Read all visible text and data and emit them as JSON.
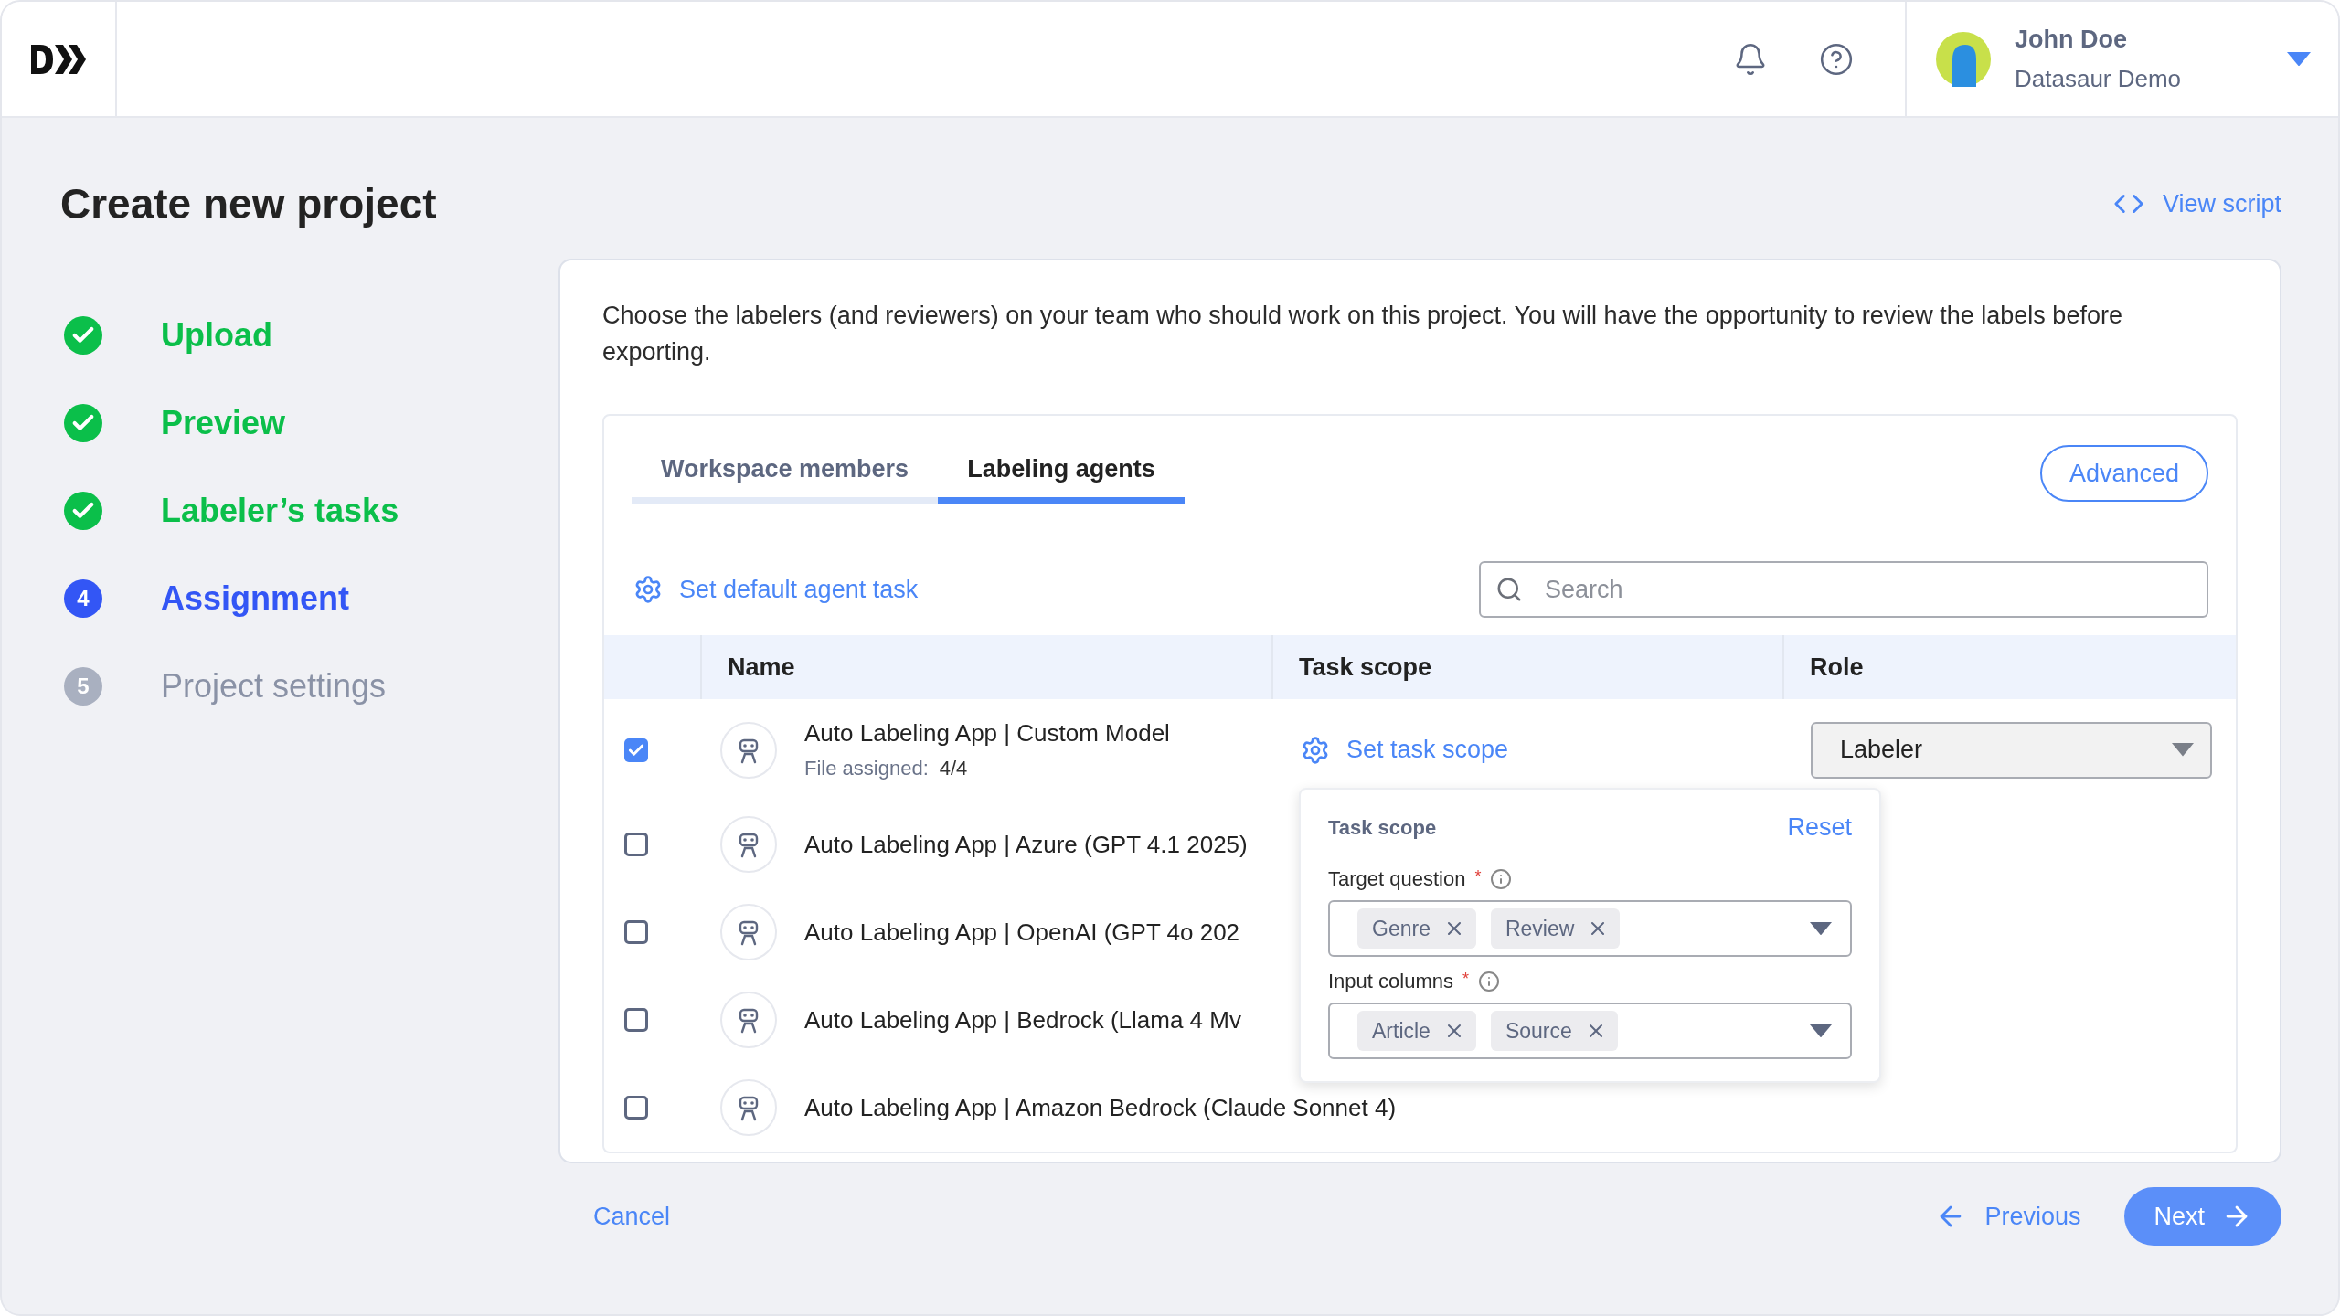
{
  "header": {
    "user_name": "John Doe",
    "workspace": "Datasaur Demo"
  },
  "page_title": "Create new project",
  "view_script": "View script",
  "steps": [
    {
      "label": "Upload",
      "completed": true,
      "selected": false
    },
    {
      "label": "Preview",
      "completed": true,
      "selected": false
    },
    {
      "label": "Labeler’s tasks",
      "completed": true,
      "selected": false
    },
    {
      "label": "Assignment",
      "completed": false,
      "selected": true,
      "number": "4"
    },
    {
      "label": "Project settings",
      "completed": false,
      "selected": false,
      "number": "5"
    }
  ],
  "description": "Choose the labelers (and reviewers) on your team who should work on this project. You will have the opportunity to review the labels before exporting.",
  "tabs": [
    {
      "label": "Workspace members",
      "selected": false
    },
    {
      "label": "Labeling agents",
      "selected": true
    }
  ],
  "advanced_button": "Advanced",
  "default_task_link": "Set default agent task",
  "search": {
    "placeholder": "Search"
  },
  "table": {
    "columns": [
      "Name",
      "Task scope",
      "Role"
    ],
    "rows": [
      {
        "name": "Auto Labeling App | Custom Model",
        "checked": true,
        "file_assigned_label": "File assigned:",
        "file_assigned": "4/4",
        "task_scope_link": "Set task scope",
        "role": "Labeler"
      },
      {
        "name": "Auto Labeling App | Azure (GPT 4.1 2025)",
        "checked": false
      },
      {
        "name": "Auto Labeling App | OpenAI (GPT 4o 202",
        "checked": false
      },
      {
        "name": "Auto Labeling App | Bedrock (Llama 4 Mv",
        "checked": false
      },
      {
        "name": "Auto Labeling App | Amazon Bedrock (Claude Sonnet 4)",
        "checked": false
      }
    ]
  },
  "task_scope_popover": {
    "title": "Task scope",
    "reset": "Reset",
    "fields": [
      {
        "label": "Target question",
        "required_mark": "*",
        "tags": [
          "Genre",
          "Review"
        ]
      },
      {
        "label": "Input columns",
        "required_mark": "*",
        "tags": [
          "Article",
          "Source"
        ]
      }
    ]
  },
  "footer": {
    "cancel": "Cancel",
    "previous": "Previous",
    "next": "Next"
  }
}
